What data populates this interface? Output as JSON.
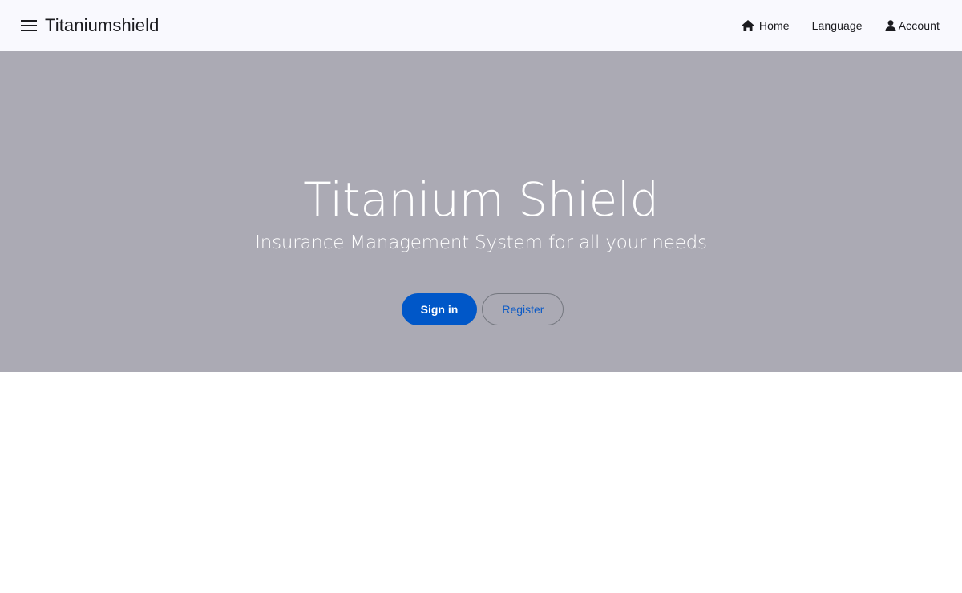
{
  "app": {
    "brand": "Titaniumshield",
    "menu_icon": "menu-icon"
  },
  "nav": {
    "home_label": "Home",
    "home_icon": "home-icon",
    "language_label": "Language",
    "account_label": "Account",
    "account_icon": "person-icon"
  },
  "hero": {
    "title": "Titanium Shield",
    "subtitle": "Insurance Management System for all your needs",
    "sign_in_label": "Sign in",
    "register_label": "Register"
  },
  "colors": {
    "topbar_bg": "#f9f9fe",
    "hero_bg": "#abaab4",
    "primary": "#0057c8",
    "outline_text": "#0d5bc6"
  }
}
